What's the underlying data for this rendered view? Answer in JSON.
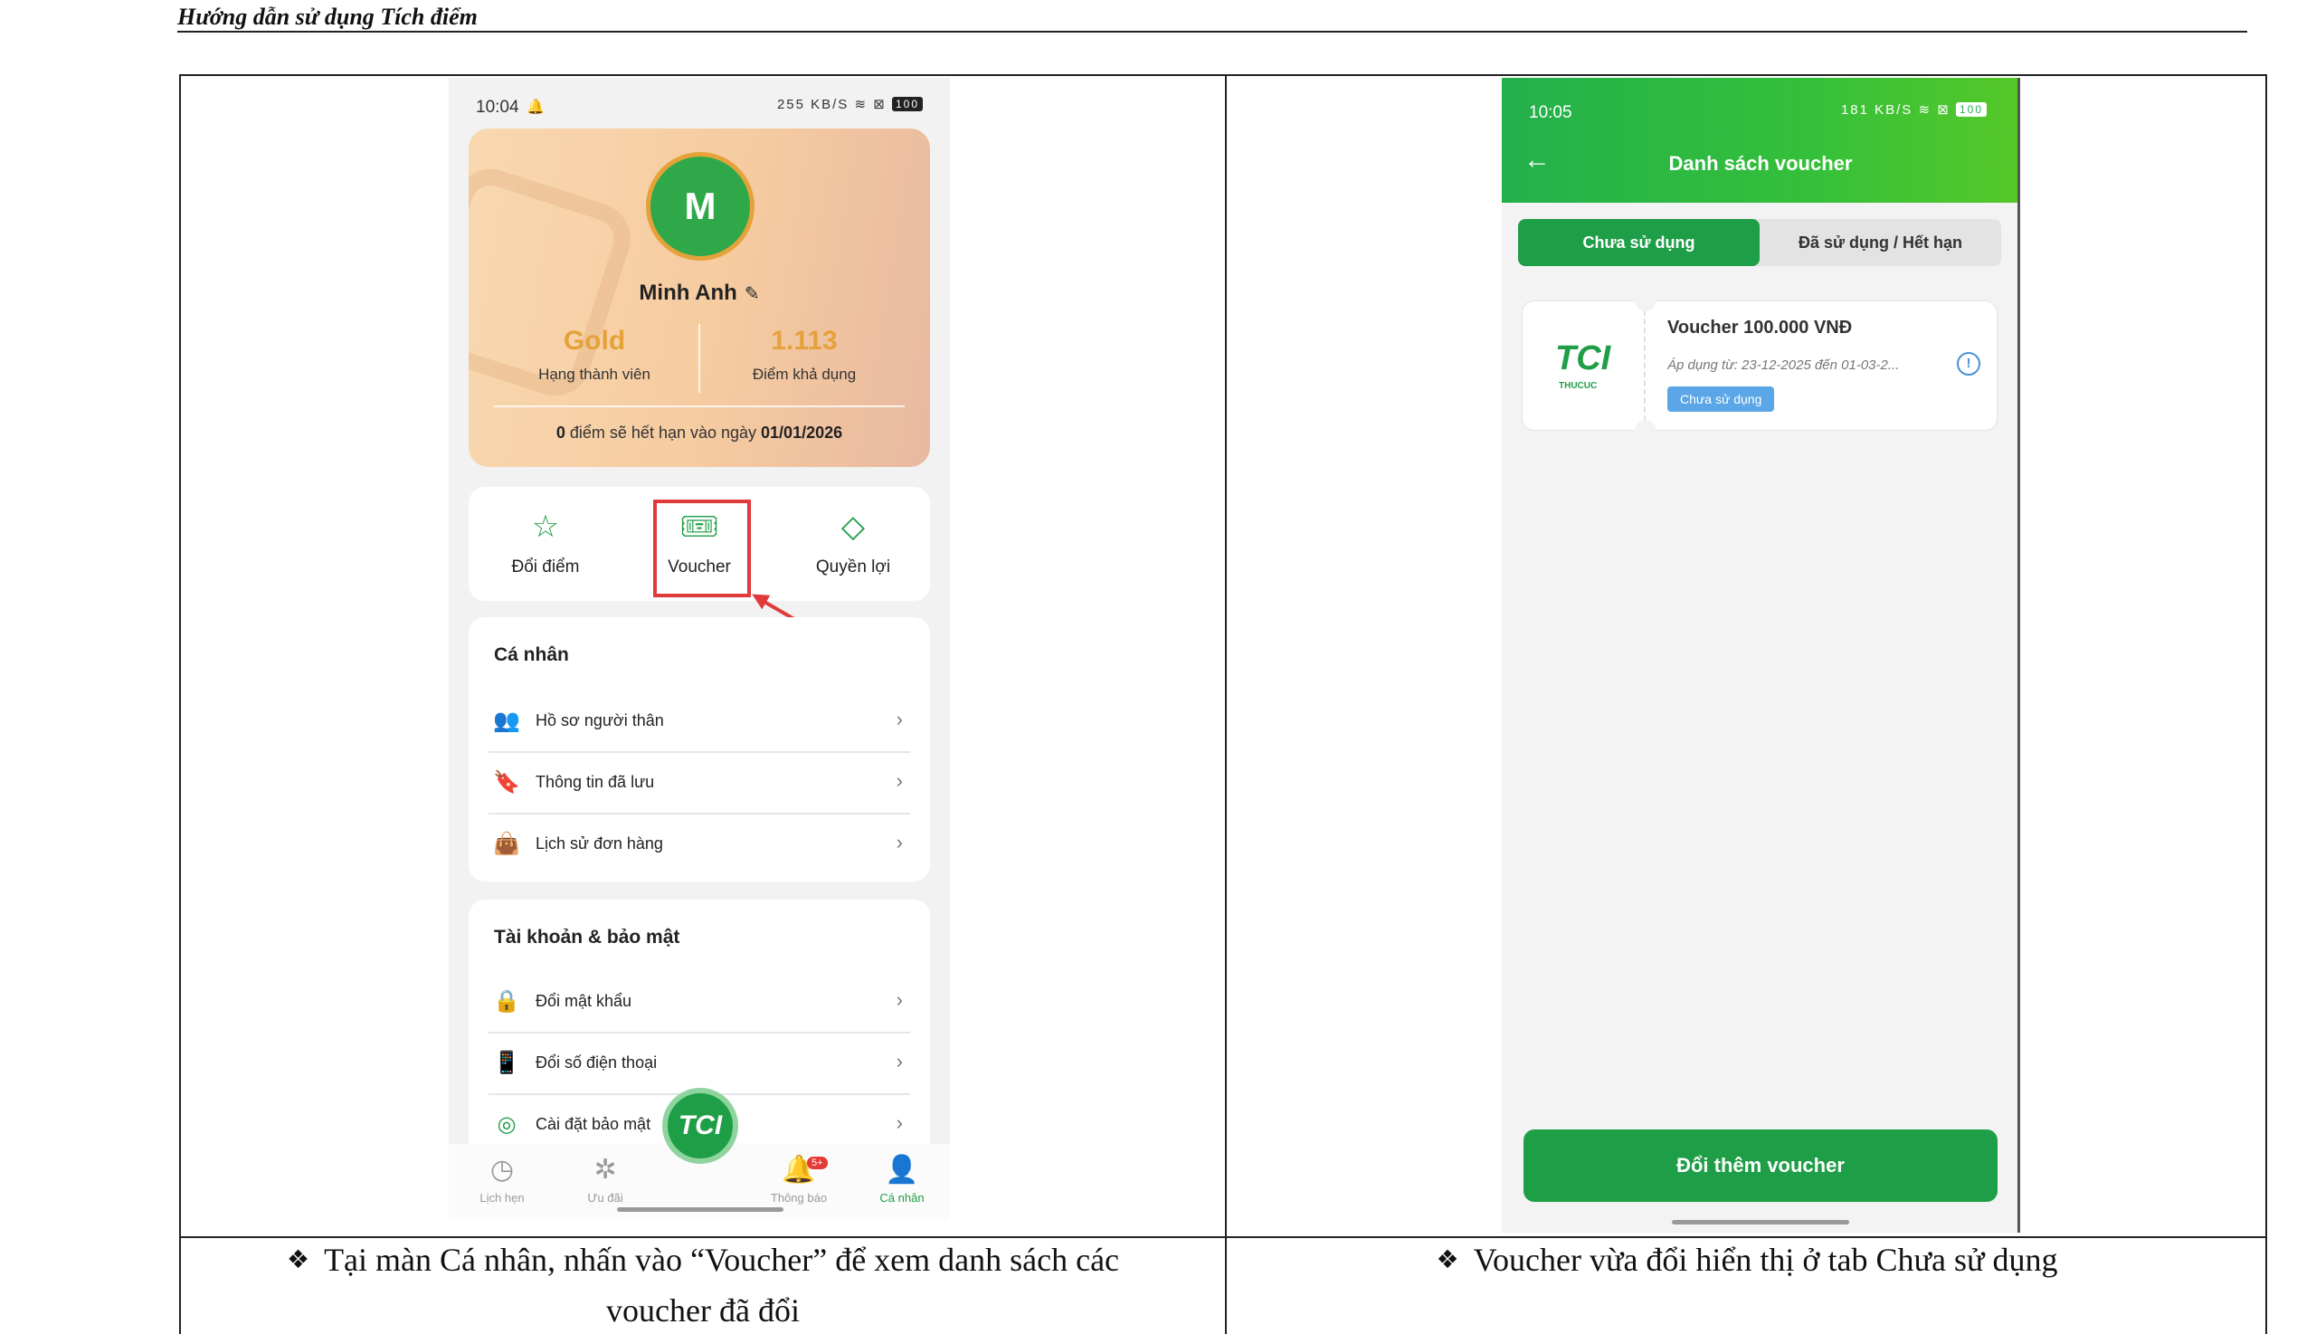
{
  "doc": {
    "header": "Hướng dẫn sử dụng Tích điểm"
  },
  "phone1": {
    "status": {
      "time": "10:04",
      "net": "255 KB/S",
      "battery": "100"
    },
    "profile": {
      "initial": "M",
      "name": "Minh Anh",
      "tier_value": "Gold",
      "tier_label": "Hạng thành viên",
      "points_value": "1.113",
      "points_label": "Điểm khả dụng",
      "expire_points": "0",
      "expire_text": " điểm sẽ hết hạn vào ngày ",
      "expire_date": "01/01/2026"
    },
    "quick": [
      {
        "label": "Đổi điểm",
        "icon": "star-icon"
      },
      {
        "label": "Voucher",
        "icon": "ticket-icon"
      },
      {
        "label": "Quyền lợi",
        "icon": "diamond-icon"
      }
    ],
    "personal": {
      "title": "Cá nhân",
      "items": [
        {
          "label": "Hồ sơ người thân",
          "icon": "people-icon"
        },
        {
          "label": "Thông tin đã lưu",
          "icon": "bookmark-icon"
        },
        {
          "label": "Lịch sử đơn hàng",
          "icon": "bag-icon"
        }
      ]
    },
    "security": {
      "title": "Tài khoản & bảo mật",
      "items": [
        {
          "label": "Đổi mật khẩu",
          "icon": "lock-icon"
        },
        {
          "label": "Đổi số điện thoại",
          "icon": "phone-icon"
        },
        {
          "label": "Cài đặt bảo mật",
          "icon": "fingerprint-icon"
        }
      ]
    },
    "tabs": [
      {
        "label": "Lịch hẹn",
        "icon": "clock-icon"
      },
      {
        "label": "Ưu đãi",
        "icon": "percent-icon"
      },
      {
        "label": "Thông báo",
        "icon": "bell-icon",
        "badge": "5+"
      },
      {
        "label": "Cá nhân",
        "icon": "person-icon"
      }
    ],
    "fab_label": "TCI"
  },
  "phone2": {
    "status": {
      "time": "10:05",
      "net": "181 KB/S",
      "battery": "100"
    },
    "title": "Danh sách voucher",
    "tabs": [
      "Chưa sử dụng",
      "Đã sử dụng / Hết hạn"
    ],
    "voucher": {
      "logo": "TCI",
      "logo_sub": "THUCUC",
      "title": "Voucher 100.000 VNĐ",
      "date": "Áp dụng từ: 23-12-2025 đến 01-03-2...",
      "status": "Chưa sử dụng"
    },
    "cta": "Đổi thêm voucher"
  },
  "captions": {
    "left_line1": "Tại màn Cá nhân, nhấn vào “Voucher” để xem danh sách các",
    "left_line2": "voucher đã đổi",
    "right": "Voucher vừa đổi hiển thị ở tab Chưa sử dụng",
    "bullet": "❖"
  },
  "colors": {
    "brand_green": "#1e9e46",
    "gold": "#e5a23a",
    "highlight_red": "#e03a3a",
    "badge_blue": "#5aa6e6"
  }
}
